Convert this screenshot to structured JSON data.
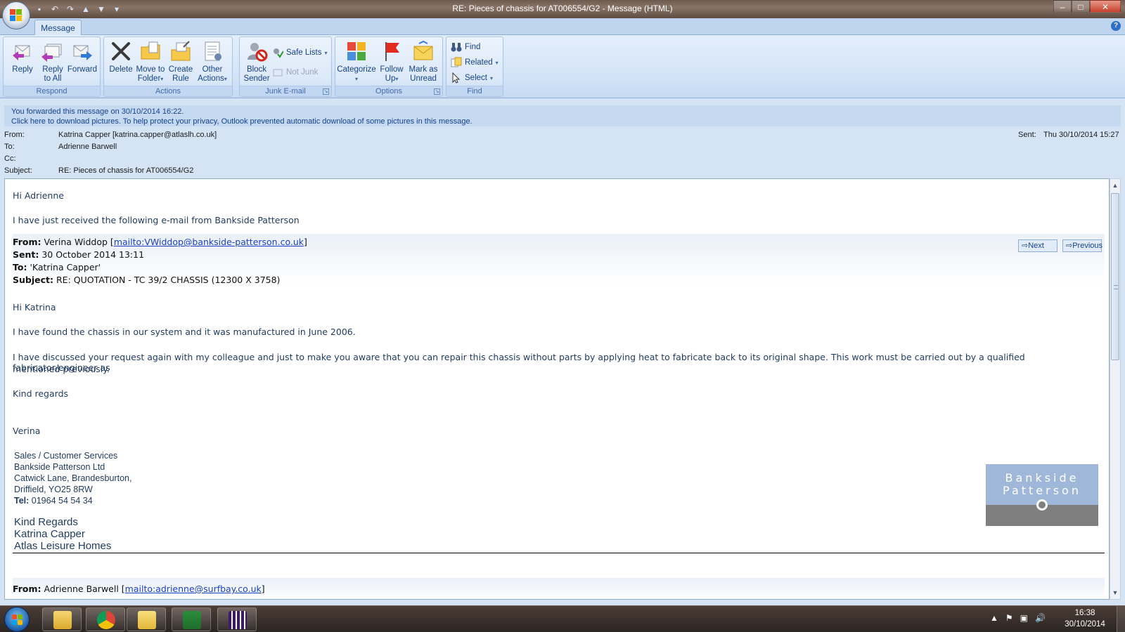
{
  "window": {
    "title": "RE: Pieces of chassis for AT006554/G2 - Message (HTML)",
    "minimize": "–",
    "maximize": "□",
    "close": "✕"
  },
  "ribbon": {
    "tab": "Message",
    "help": "?",
    "respond": {
      "label": "Respond",
      "reply": "Reply",
      "reply_all_1": "Reply",
      "reply_all_2": "to All",
      "forward": "Forward"
    },
    "actions": {
      "label": "Actions",
      "delete": "Delete",
      "move_1": "Move to",
      "move_2": "Folder",
      "rule_1": "Create",
      "rule_2": "Rule",
      "other_1": "Other",
      "other_2": "Actions"
    },
    "junk": {
      "label": "Junk E-mail",
      "block_1": "Block",
      "block_2": "Sender",
      "safe_lists": "Safe Lists",
      "not_junk": "Not Junk"
    },
    "options": {
      "label": "Options",
      "categorize": "Categorize",
      "follow_1": "Follow",
      "follow_2": "Up",
      "mark_1": "Mark as",
      "mark_2": "Unread"
    },
    "find": {
      "label": "Find",
      "find": "Find",
      "related": "Related",
      "select": "Select"
    }
  },
  "infobar": {
    "line1": "You forwarded this message on 30/10/2014 16:22.",
    "line2": "Click here to download pictures. To help protect your privacy, Outlook prevented automatic download of some pictures in this message."
  },
  "header": {
    "from_label": "From:",
    "from": "Katrina Capper [katrina.capper@atlaslh.co.uk]",
    "to_label": "To:",
    "to": "Adrienne Barwell",
    "cc_label": "Cc:",
    "cc": "",
    "subject_label": "Subject:",
    "subject": "RE: Pieces of chassis for AT006554/G2",
    "sent_label": "Sent:",
    "sent": "Thu 30/10/2014 15:27"
  },
  "body": {
    "greeting": "Hi Adrienne",
    "intro": "I have just received the following e-mail from Bankside Patterson",
    "quoted": {
      "from_label": "From:",
      "from_name": "Verina Widdop [",
      "from_link": "mailto:VWiddop@bankside-patterson.co.uk",
      "from_end": "]",
      "sent_label": "Sent:",
      "sent": "30 October 2014 13:11",
      "to_label": "To:",
      "to": "'Katrina Capper'",
      "subject_label": "Subject:",
      "subject": "RE: QUOTATION - TC 39/2 CHASSIS (12300 X 3758)",
      "next": "Next",
      "previous": "Previous"
    },
    "q_greeting": "Hi Katrina",
    "q_p1": "I have found the chassis in our system and it was manufactured in June 2006.",
    "q_p2a": "I have discussed your request again with my colleague and just to make you aware that you can repair this chassis without parts by applying heat to fabricate back to its original shape.  This work must be carried out by a qualified fabricator/engineer as",
    "q_p2b": "mentioned previously.",
    "q_regards": "Kind regards",
    "q_name": "Verina",
    "sig1": "Sales / Customer Services",
    "sig2": "Bankside Patterson Ltd",
    "sig3": "Catwick Lane, Brandesburton,",
    "sig4": "Driffield, YO25 8RW",
    "sig_tel_label": "Tel:",
    "sig_tel": "01964 54 54 34",
    "kr1": "Kind Regards",
    "kr2": "Katrina Capper",
    "kr3": "Atlas Leisure Homes",
    "logo_line1": "Bankside",
    "logo_line2": "Patterson",
    "next_from_label": "From:",
    "next_from_name": "Adrienne Barwell [",
    "next_from_link": "mailto:adrienne@surfbay.co.uk",
    "next_from_end": "]"
  },
  "taskbar": {
    "time": "16:38",
    "date": "30/10/2014"
  }
}
